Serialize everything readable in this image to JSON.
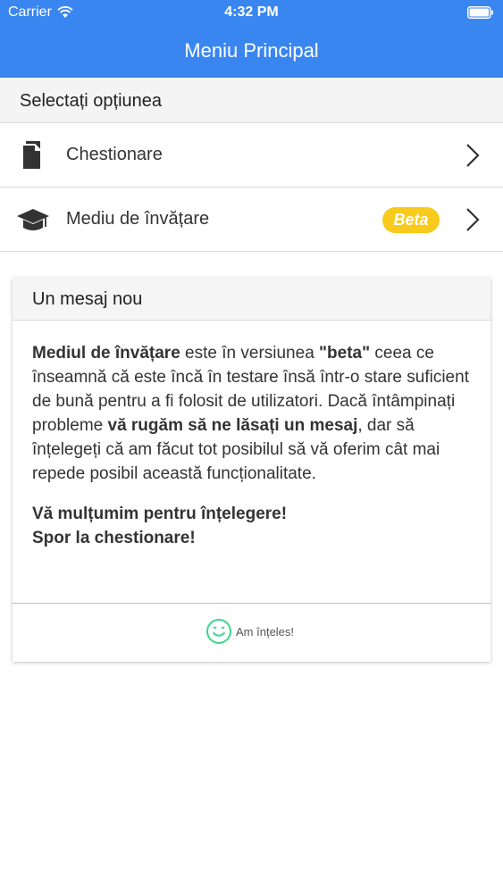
{
  "status_bar": {
    "carrier": "Carrier",
    "time": "4:32 PM"
  },
  "nav": {
    "title": "Meniu Principal"
  },
  "section": {
    "title": "Selectați opțiunea"
  },
  "menu": [
    {
      "label": "Chestionare",
      "icon": "document-icon"
    },
    {
      "label": "Mediu de învățare",
      "icon": "graduation-cap-icon",
      "badge": "Beta"
    }
  ],
  "message": {
    "title": "Un mesaj nou",
    "p1": {
      "b1": "Mediul de învățare",
      "t1": " este în versiunea ",
      "b2": "\"beta\"",
      "t2": " ceea ce înseamnă că este încă în testare însă într-o stare suficient de bună pentru a fi folosit de utilizatori. Dacă întâmpinați probleme ",
      "b3": "vă rugăm să ne lăsați un mesaj",
      "t3": ", dar să înțelegeți că am făcut tot posibilul să vă oferim cât mai repede posibil această funcționalitate."
    },
    "thanks_line1": "Vă mulțumim pentru înțelegere!",
    "thanks_line2": "Spor la chestionare!",
    "ack_label": "Am înțeles!"
  },
  "colors": {
    "header": "#3a86f1",
    "badge": "#f8ca1c",
    "ack_icon": "#3dd68c"
  }
}
